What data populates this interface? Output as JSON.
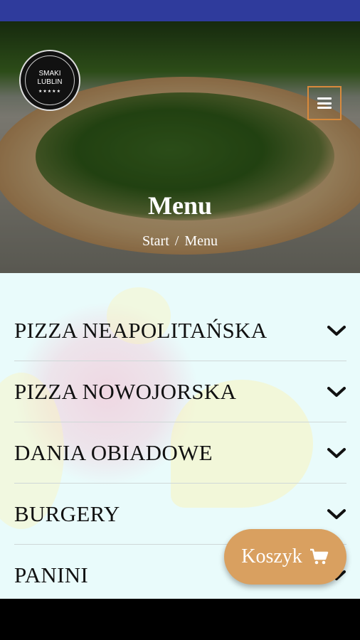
{
  "hero": {
    "logo_line1": "SMAKI",
    "logo_line2": "LUBLIN",
    "title": "Menu",
    "breadcrumb": {
      "home": "Start",
      "separator": "/",
      "current": "Menu"
    }
  },
  "menu_categories": [
    {
      "label": "PIZZA NEAPOLITAŃSKA"
    },
    {
      "label": "PIZZA NOWOJORSKA"
    },
    {
      "label": "DANIA OBIADOWE"
    },
    {
      "label": "BURGERY"
    },
    {
      "label": "PANINI"
    }
  ],
  "cart": {
    "label": "Koszyk",
    "icon": "cart-icon"
  },
  "colors": {
    "accent": "#d9a060",
    "menu_border": "#d88a3c",
    "status_bar": "#2f3b9c",
    "content_bg": "#e9fbfb"
  }
}
